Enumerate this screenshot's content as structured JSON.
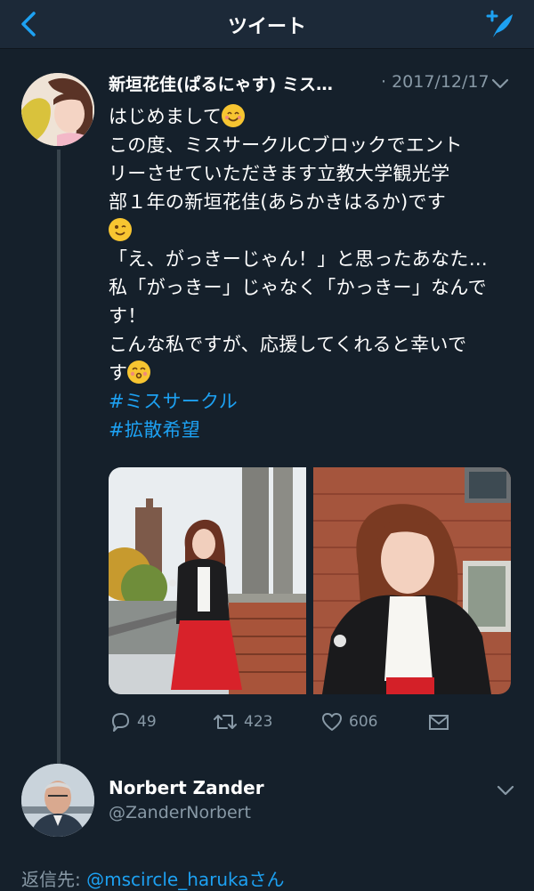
{
  "nav": {
    "title": "ツイート"
  },
  "tweet": {
    "author_name": "新垣花佳(ぱるにゃす) ミス…",
    "date": "· 2017/12/17",
    "lines": [
      "はじめまして",
      "この度、ミスサークルCブロックでエント",
      "リーさせていただきます立教大学観光学",
      "部１年の新垣花佳(あらかきはるか)です",
      "「え、がっきーじゃん！」と思ったあなた…",
      "私「がっきー」じゃなく「かっきー」なんで",
      "す！",
      "こんな私ですが、応援してくれると幸いで",
      "す"
    ],
    "hashtags": [
      "#ミスサークル",
      "#拡散希望"
    ],
    "counts": {
      "replies": "49",
      "retweets": "423",
      "likes": "606"
    }
  },
  "reply_user": {
    "name": "Norbert Zander",
    "handle": "@ZanderNorbert"
  },
  "reply_to": {
    "prefix": "返信先: ",
    "mention": "@mscircle_haruka",
    "suffix": "さん"
  },
  "colors": {
    "background": "#15202b",
    "accent": "#1da1f2",
    "muted": "#8899a6"
  }
}
